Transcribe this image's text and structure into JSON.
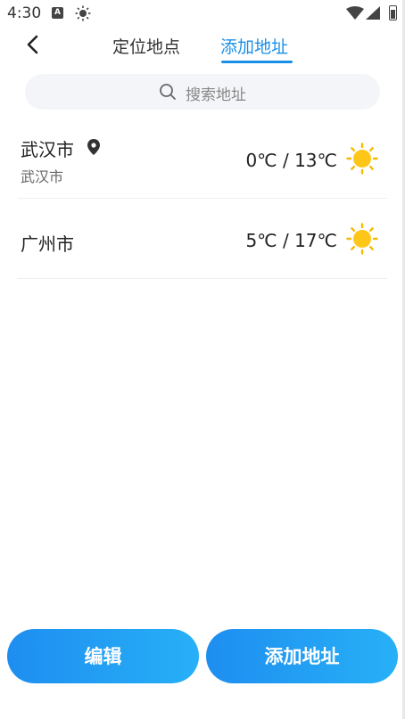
{
  "status_bar": {
    "time": "4:30",
    "icons": [
      "a-icon",
      "sun-icon",
      "wifi-icon",
      "signal-icon",
      "battery-icon"
    ]
  },
  "header": {
    "tabs": [
      {
        "label": "定位地点",
        "active": false
      },
      {
        "label": "添加地址",
        "active": true
      }
    ],
    "accent_color": "#1a8fe8"
  },
  "search": {
    "placeholder": "搜索地址"
  },
  "cities": [
    {
      "name": "武汉市",
      "subtitle": "武汉市",
      "is_location": true,
      "temp": "0℃ / 13℃",
      "weather_icon": "sunny-icon"
    },
    {
      "name": "广州市",
      "subtitle": "",
      "is_location": false,
      "temp": "5℃ / 17℃",
      "weather_icon": "sunny-icon"
    }
  ],
  "buttons": {
    "edit_label": "编辑",
    "add_label": "添加地址"
  }
}
